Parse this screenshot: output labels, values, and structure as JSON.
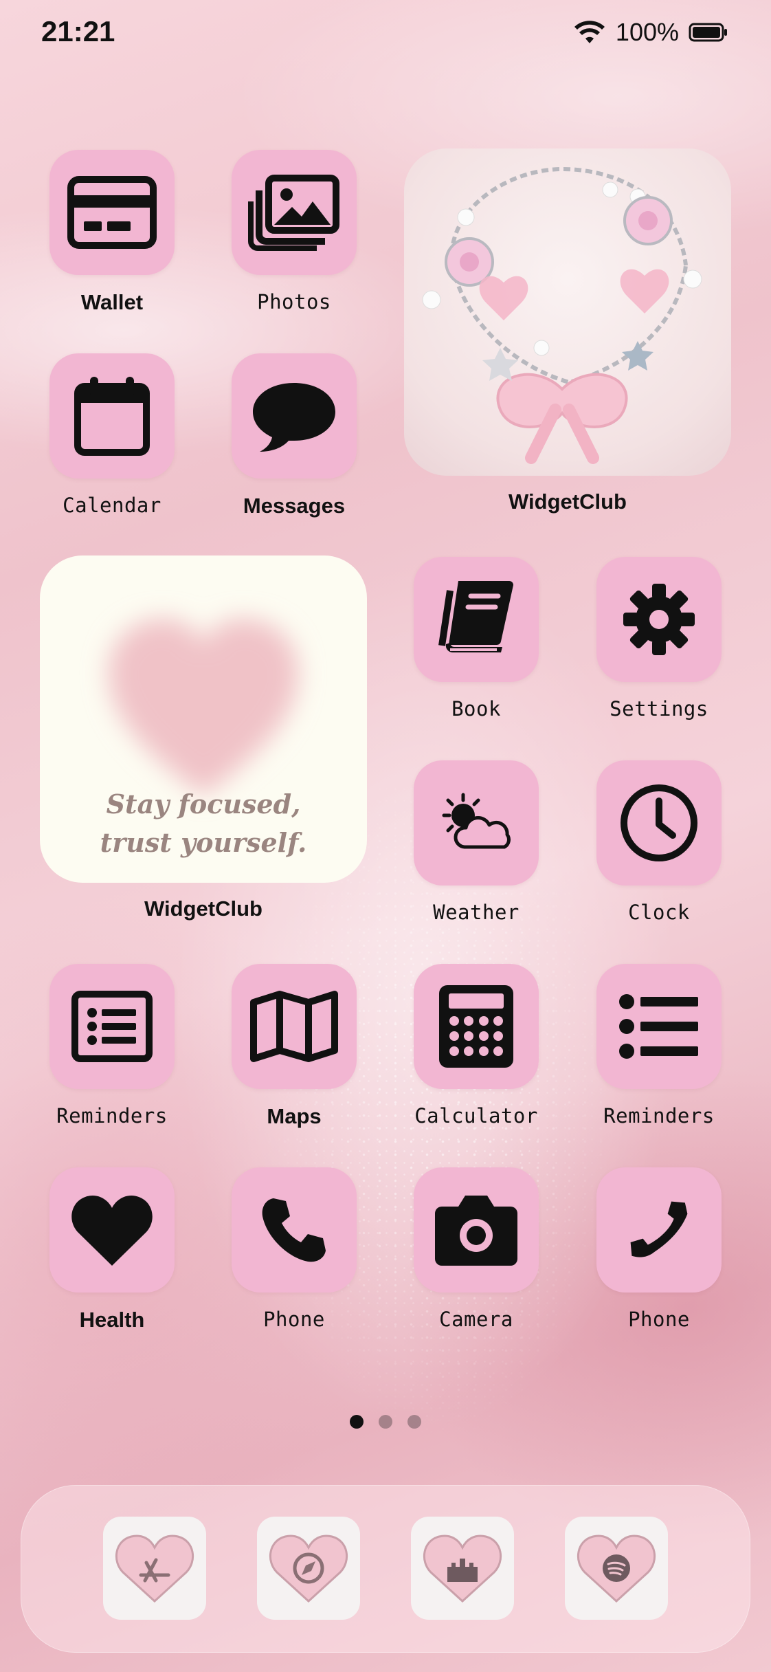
{
  "status_bar": {
    "time": "21:21",
    "battery": "100%"
  },
  "apps": {
    "wallet": "Wallet",
    "photos": "Photos",
    "calendar": "Calendar",
    "messages": "Messages",
    "book": "Book",
    "settings": "Settings",
    "weather": "Weather",
    "clock": "Clock",
    "reminders_1": "Reminders",
    "maps": "Maps",
    "calculator": "Calculator",
    "reminders_2": "Reminders",
    "health": "Health",
    "phone_1": "Phone",
    "camera": "Camera",
    "phone_2": "Phone"
  },
  "widgets": {
    "photo_widget_label": "WidgetClub",
    "quote_widget_label": "WidgetClub",
    "quote_text": "Stay focused,\ntrust yourself."
  },
  "page_indicator": {
    "pages": 3,
    "current": 1
  },
  "dock": {
    "icons": [
      "app-store-icon",
      "safari-compass-icon",
      "castle-icon",
      "spotify-icon"
    ]
  },
  "colors": {
    "tile": "#f2b6d2",
    "glyph": "#111111",
    "quote_text": "#9a8580"
  }
}
